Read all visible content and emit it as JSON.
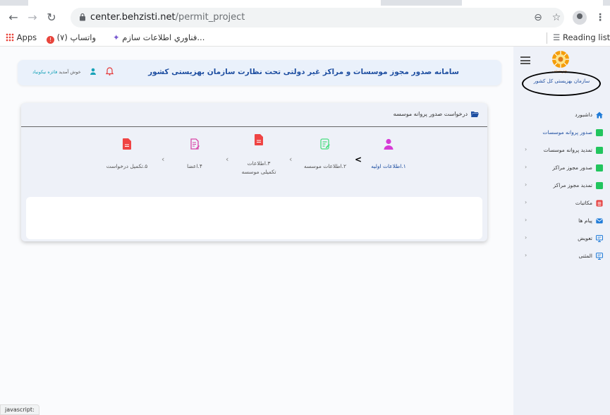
{
  "browser": {
    "url_host": "center.behzisti.net",
    "url_path": "/permit_project",
    "bookmarks": {
      "apps": "Apps",
      "whatsapp": "واتساپ (۷)",
      "fanavari": "فناوري اطلاعات سازم...",
      "reading_list": "Reading list"
    }
  },
  "header": {
    "title": "سامانه صدور مجوز موسسات و مراکز غیر دولتی تحت نظارت سازمان بهزیستی کشور",
    "welcome_prefix": "خوش آمدید",
    "user_name": "فائزه نیکونیاد"
  },
  "sidebar": {
    "logo_caption": "بهزیستی",
    "org_name": "سازمان بهزیستی کل کشور",
    "items": [
      {
        "label": "داشبورد",
        "icon": "home-icon",
        "color": "#1f7bd8",
        "chevron": ""
      },
      {
        "label": "صدور پروانه موسسات",
        "icon": "document-icon",
        "color": "#22c55e",
        "chevron": ""
      },
      {
        "label": "تمدید پروانه موسسات",
        "icon": "document-icon",
        "color": "#22c55e",
        "chevron": "‹"
      },
      {
        "label": "صدور مجوز مراکز",
        "icon": "document-icon",
        "color": "#22c55e",
        "chevron": "‹"
      },
      {
        "label": "تمدید مجوز مراکز",
        "icon": "document-icon",
        "color": "#22c55e",
        "chevron": "‹"
      },
      {
        "label": "مکاتبات",
        "icon": "list-icon",
        "color": "#e53e3e",
        "chevron": "‹"
      },
      {
        "label": "پیام ها",
        "icon": "envelope-icon",
        "color": "#1f7bd8",
        "chevron": "‹"
      },
      {
        "label": "تعویض",
        "icon": "monitor-icon",
        "color": "#1f7bd8",
        "chevron": "‹"
      },
      {
        "label": "المثنی",
        "icon": "monitor-icon",
        "color": "#1f7bd8",
        "chevron": "‹"
      }
    ]
  },
  "card": {
    "title": "درخواست صدور پروانه موسسه",
    "steps": [
      {
        "label": "۱.اطلاعات اولیه",
        "icon": "user-icon",
        "color": "#d63bd6"
      },
      {
        "label": "۲.اطلاعات موسسه",
        "icon": "edit-document-icon",
        "color": "#4ade80"
      },
      {
        "label": "۳.اطلاعات تکمیلی موسسه",
        "icon": "document-icon",
        "color": "#ef4444"
      },
      {
        "label": "۴.اعضا",
        "icon": "document-edit-icon",
        "color": "#d946a8"
      },
      {
        "label": "۵.تکمیل درخواست",
        "icon": "document-icon",
        "color": "#ef4444"
      }
    ]
  },
  "status_bar": "javascript:"
}
